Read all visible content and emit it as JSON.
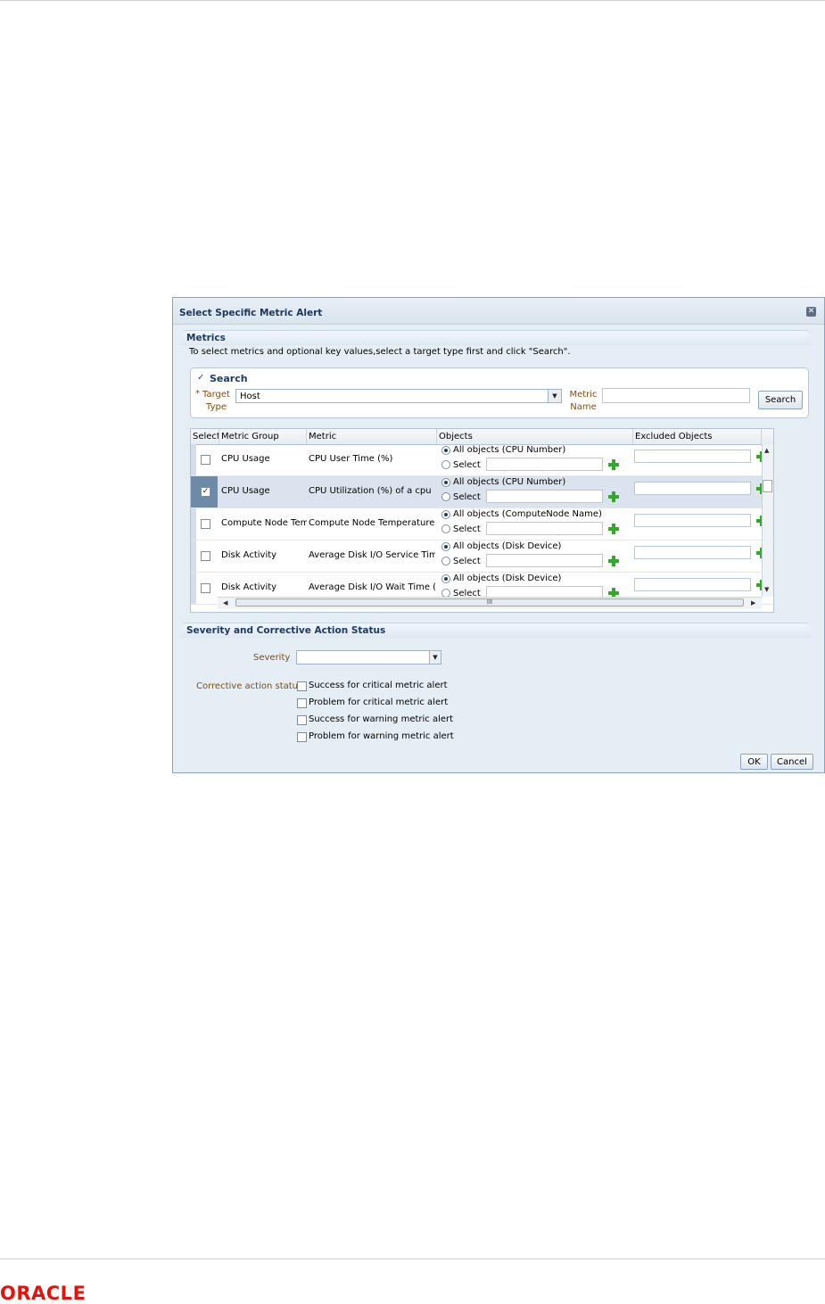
{
  "dialog": {
    "title": "Select Specific Metric Alert",
    "close_icon": "close-icon"
  },
  "metrics": {
    "section_title": "Metrics",
    "hint": "To select metrics and optional key values,select a target type first and click \"Search\".",
    "search": {
      "toggle_glyph": "✓",
      "title": "Search",
      "required_marker": "*",
      "target_type_label": "Target Type",
      "target_type_value": "Host",
      "metric_name_label": "Metric Name",
      "metric_name_value": "",
      "search_button": "Search"
    },
    "table": {
      "columns": [
        "Select",
        "Metric Group",
        "Metric",
        "Objects",
        "Excluded Objects"
      ],
      "rows": [
        {
          "checked": false,
          "metric_group": "CPU Usage",
          "metric": "CPU User Time (%)",
          "all_objects": "All objects (CPU Number)",
          "select_label": "Select"
        },
        {
          "checked": true,
          "metric_group": "CPU Usage",
          "metric": "CPU Utilization (%) of a cpu",
          "all_objects": "All objects (CPU Number)",
          "select_label": "Select"
        },
        {
          "checked": false,
          "metric_group": "Compute Node Tempe",
          "metric": "Compute Node Temperature",
          "all_objects": "All objects (ComputeNode Name)",
          "select_label": "Select"
        },
        {
          "checked": false,
          "metric_group": "Disk Activity",
          "metric": "Average Disk I/O Service Time (",
          "all_objects": "All objects (Disk Device)",
          "select_label": "Select"
        },
        {
          "checked": false,
          "metric_group": "Disk Activity",
          "metric": "Average Disk I/O Wait Time (ms",
          "all_objects": "All objects (Disk Device)",
          "select_label": "Select"
        }
      ],
      "check_glyph": "✓",
      "scroll_grip": "III",
      "arrow_left": "◀",
      "arrow_right": "▶",
      "arrow_up": "▲",
      "arrow_down": "▼"
    }
  },
  "severity": {
    "section_title": "Severity and Corrective Action Status",
    "severity_label": "Severity",
    "severity_value": "",
    "corrective_label": "Corrective action status",
    "corrective_options": [
      "Success for critical metric alert",
      "Problem for critical metric alert",
      "Success for warning metric alert",
      "Problem for warning metric alert"
    ]
  },
  "buttons": {
    "ok": "OK",
    "cancel": "Cancel"
  },
  "footer": {
    "logo_text": "ORACLE"
  },
  "colors": {
    "oracle_red": "#e3120b",
    "add_green": "#33a82b",
    "selected_row": "#dbe4ee"
  },
  "icons": {
    "dropdown": "chevron-down-icon",
    "add": "plus-icon"
  }
}
